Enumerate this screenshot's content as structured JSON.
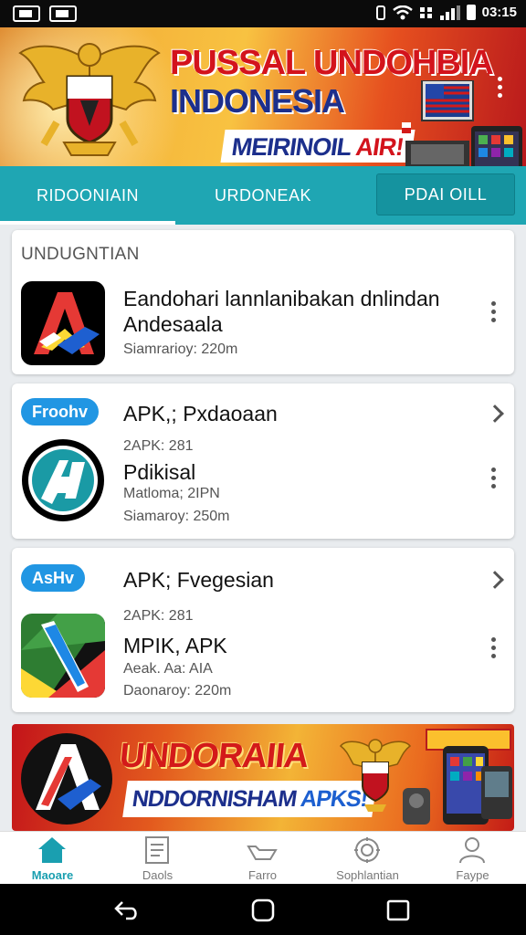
{
  "status_bar": {
    "time": "03:15",
    "icons": [
      "screenshot-icon",
      "notification-icon",
      "vibrate-icon",
      "wifi-icon",
      "data-icon",
      "signal-icon",
      "battery-icon"
    ]
  },
  "banner": {
    "title_line1": "PUSSAL UNDOHBIA",
    "title_line2": "INDONESIA",
    "subtitle_main": "MEIRINOIL",
    "subtitle_accent": "AIR!"
  },
  "tabs": [
    {
      "label": "RIDOONIAIN",
      "active": true
    },
    {
      "label": "URDONEAK",
      "active": false
    },
    {
      "label": "PDAI OILL",
      "active": false
    }
  ],
  "section_title": "UNDUGNTIAN",
  "apps": [
    {
      "title_line1": "Eandohari lannlanibakan dnlindan",
      "title_line2": "Andesaala",
      "size": "Siamrarioy: 220m"
    },
    {
      "badge": "Froohv",
      "title": "APK,; Pxdaoaan",
      "meta": "2APK: 281",
      "name": "Pdikisal",
      "detail": "Matloma; 2IPN",
      "size": "Siamaroy: 250m"
    },
    {
      "badge": "AsHv",
      "title": "APK; Fvegesian",
      "meta": "2APK: 281",
      "name": "MPIK, APK",
      "detail": "Aeak. Aa: AIA",
      "size": "Daonaroy: 220m"
    }
  ],
  "promo": {
    "title": "UNDORAIIA",
    "subtitle_main": "NDDORNISHAM",
    "subtitle_accent": "APKS!"
  },
  "bottom_nav": [
    {
      "label": "Maoare",
      "icon": "home-icon",
      "active": true
    },
    {
      "label": "Daols",
      "icon": "document-icon",
      "active": false
    },
    {
      "label": "Farro",
      "icon": "folder-icon",
      "active": false
    },
    {
      "label": "Sophlantian",
      "icon": "settings-icon",
      "active": false
    },
    {
      "label": "Faype",
      "icon": "profile-icon",
      "active": false
    }
  ],
  "colors": {
    "accent": "#1fa6b3",
    "badge": "#2196e3",
    "banner_red": "#d3131c",
    "banner_blue": "#1c2f8c"
  }
}
